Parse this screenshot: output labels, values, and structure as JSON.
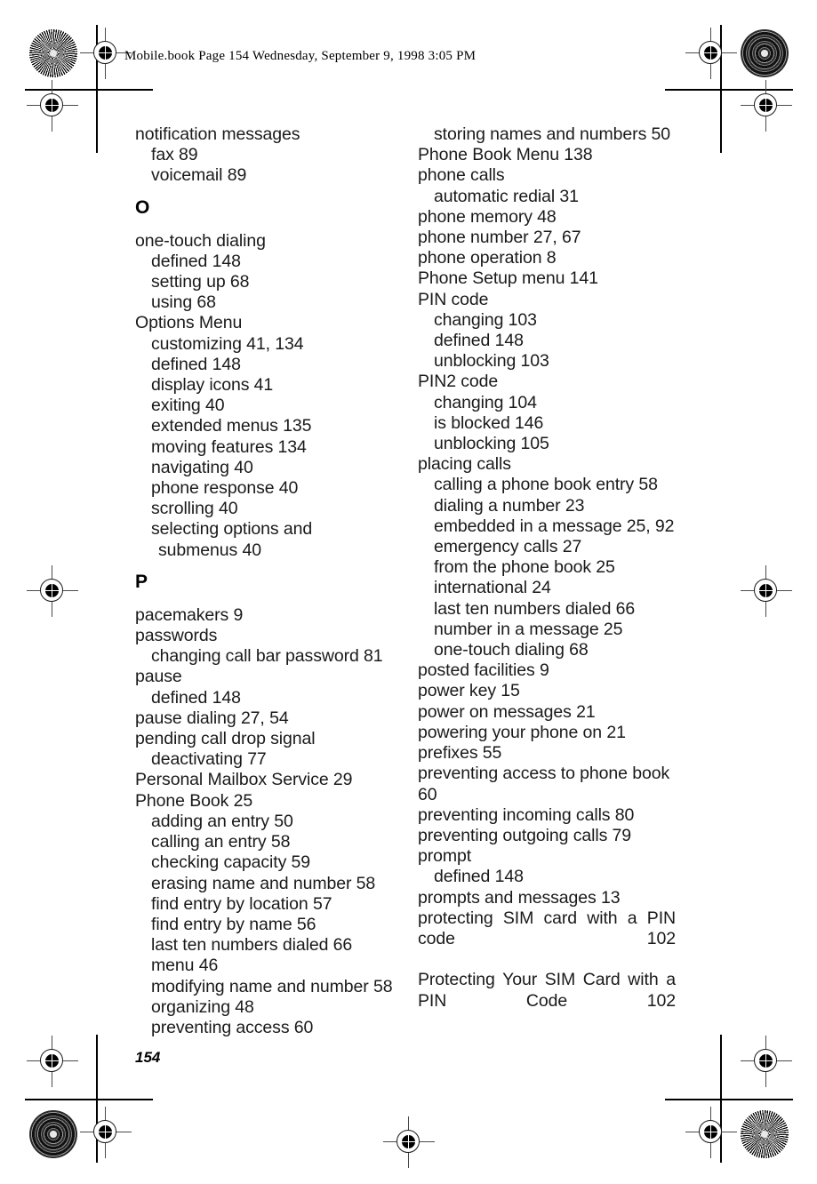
{
  "page": {
    "header": "Mobile.book  Page 154  Wednesday, September 9, 1998  3:05 PM",
    "folio": "154",
    "ink_color": "#000000",
    "paper_color": "#ffffff"
  },
  "marks": {
    "registration_icon": "registration-crosshair-icon",
    "radial_target_icon": "radial-starburst-target-icon",
    "ring_target_icon": "concentric-ring-target-icon"
  },
  "index": {
    "left_column": [
      {
        "type": "entry",
        "level": 0,
        "text": "notification messages"
      },
      {
        "type": "entry",
        "level": 1,
        "text": "fax 89"
      },
      {
        "type": "entry",
        "level": 1,
        "text": "voicemail 89"
      },
      {
        "type": "letter",
        "text": "O"
      },
      {
        "type": "entry",
        "level": 0,
        "text": "one-touch dialing"
      },
      {
        "type": "entry",
        "level": 1,
        "text": "defined 148"
      },
      {
        "type": "entry",
        "level": 1,
        "text": "setting up 68"
      },
      {
        "type": "entry",
        "level": 1,
        "text": "using 68"
      },
      {
        "type": "entry",
        "level": 0,
        "text": "Options Menu"
      },
      {
        "type": "entry",
        "level": 1,
        "text": "customizing 41, 134"
      },
      {
        "type": "entry",
        "level": 1,
        "text": "defined 148"
      },
      {
        "type": "entry",
        "level": 1,
        "text": "display icons 41"
      },
      {
        "type": "entry",
        "level": 1,
        "text": "exiting 40"
      },
      {
        "type": "entry",
        "level": 1,
        "text": "extended menus 135"
      },
      {
        "type": "entry",
        "level": 1,
        "text": "moving features 134"
      },
      {
        "type": "entry",
        "level": 1,
        "text": "navigating 40"
      },
      {
        "type": "entry",
        "level": 1,
        "text": "phone response 40"
      },
      {
        "type": "entry",
        "level": 1,
        "text": "scrolling 40"
      },
      {
        "type": "entry",
        "level": 1,
        "wrap": true,
        "text": "selecting options and submenus 40"
      },
      {
        "type": "letter",
        "text": "P"
      },
      {
        "type": "entry",
        "level": 0,
        "text": "pacemakers 9"
      },
      {
        "type": "entry",
        "level": 0,
        "text": "passwords"
      },
      {
        "type": "entry",
        "level": 1,
        "text": "changing call bar password 81"
      },
      {
        "type": "entry",
        "level": 0,
        "text": "pause"
      },
      {
        "type": "entry",
        "level": 1,
        "text": "defined 148"
      },
      {
        "type": "entry",
        "level": 0,
        "text": "pause dialing 27, 54"
      },
      {
        "type": "entry",
        "level": 0,
        "text": "pending call drop signal"
      },
      {
        "type": "entry",
        "level": 1,
        "text": "deactivating 77"
      },
      {
        "type": "entry",
        "level": 0,
        "text": "Personal Mailbox Service 29"
      },
      {
        "type": "entry",
        "level": 0,
        "text": "Phone Book 25"
      },
      {
        "type": "entry",
        "level": 1,
        "text": "adding an entry 50"
      },
      {
        "type": "entry",
        "level": 1,
        "text": "calling an entry 58"
      },
      {
        "type": "entry",
        "level": 1,
        "text": "checking capacity 59"
      },
      {
        "type": "entry",
        "level": 1,
        "text": "erasing name and number 58"
      },
      {
        "type": "entry",
        "level": 1,
        "text": "find entry by location 57"
      },
      {
        "type": "entry",
        "level": 1,
        "text": "find entry by name 56"
      },
      {
        "type": "entry",
        "level": 1,
        "text": "last ten numbers dialed 66"
      },
      {
        "type": "entry",
        "level": 1,
        "text": "menu 46"
      },
      {
        "type": "entry",
        "level": 1,
        "text": "modifying name and number 58"
      },
      {
        "type": "entry",
        "level": 1,
        "text": "organizing 48"
      },
      {
        "type": "entry",
        "level": 1,
        "text": "preventing access 60"
      }
    ],
    "right_column": [
      {
        "type": "entry",
        "level": 1,
        "text": "storing names and numbers 50"
      },
      {
        "type": "entry",
        "level": 0,
        "text": "Phone Book Menu 138"
      },
      {
        "type": "entry",
        "level": 0,
        "text": "phone calls"
      },
      {
        "type": "entry",
        "level": 1,
        "text": "automatic redial 31"
      },
      {
        "type": "entry",
        "level": 0,
        "text": "phone memory 48"
      },
      {
        "type": "entry",
        "level": 0,
        "text": "phone number 27, 67"
      },
      {
        "type": "entry",
        "level": 0,
        "text": "phone operation 8"
      },
      {
        "type": "entry",
        "level": 0,
        "text": "Phone Setup menu 141"
      },
      {
        "type": "entry",
        "level": 0,
        "text": "PIN code"
      },
      {
        "type": "entry",
        "level": 1,
        "text": "changing 103"
      },
      {
        "type": "entry",
        "level": 1,
        "text": "defined 148"
      },
      {
        "type": "entry",
        "level": 1,
        "text": "unblocking 103"
      },
      {
        "type": "entry",
        "level": 0,
        "text": "PIN2 code"
      },
      {
        "type": "entry",
        "level": 1,
        "text": "changing 104"
      },
      {
        "type": "entry",
        "level": 1,
        "text": "is blocked 146"
      },
      {
        "type": "entry",
        "level": 1,
        "text": "unblocking 105"
      },
      {
        "type": "entry",
        "level": 0,
        "text": "placing calls"
      },
      {
        "type": "entry",
        "level": 1,
        "text": "calling a phone book entry 58"
      },
      {
        "type": "entry",
        "level": 1,
        "text": "dialing a number 23"
      },
      {
        "type": "entry",
        "level": 1,
        "text": "embedded in a message 25, 92"
      },
      {
        "type": "entry",
        "level": 1,
        "text": "emergency calls 27"
      },
      {
        "type": "entry",
        "level": 1,
        "text": "from the phone book 25"
      },
      {
        "type": "entry",
        "level": 1,
        "text": "international 24"
      },
      {
        "type": "entry",
        "level": 1,
        "text": "last ten numbers dialed 66"
      },
      {
        "type": "entry",
        "level": 1,
        "text": "number in a message 25"
      },
      {
        "type": "entry",
        "level": 1,
        "text": "one-touch dialing 68"
      },
      {
        "type": "entry",
        "level": 0,
        "text": "posted facilities 9"
      },
      {
        "type": "entry",
        "level": 0,
        "text": "power key 15"
      },
      {
        "type": "entry",
        "level": 0,
        "text": "power on messages 21"
      },
      {
        "type": "entry",
        "level": 0,
        "text": "powering your phone on 21"
      },
      {
        "type": "entry",
        "level": 0,
        "text": "prefixes 55"
      },
      {
        "type": "entry",
        "level": 0,
        "text": "preventing access to phone book 60"
      },
      {
        "type": "entry",
        "level": 0,
        "text": "preventing incoming calls 80"
      },
      {
        "type": "entry",
        "level": 0,
        "text": "preventing outgoing calls 79"
      },
      {
        "type": "entry",
        "level": 0,
        "text": "prompt"
      },
      {
        "type": "entry",
        "level": 1,
        "text": "defined 148"
      },
      {
        "type": "entry",
        "level": 0,
        "text": "prompts and messages 13"
      },
      {
        "type": "entry",
        "level": 0,
        "justify": true,
        "text": "protecting SIM card with a PIN code 102"
      },
      {
        "type": "entry",
        "level": 0,
        "justify": true,
        "text": "Protecting Your SIM Card with a PIN Code 102"
      }
    ]
  }
}
